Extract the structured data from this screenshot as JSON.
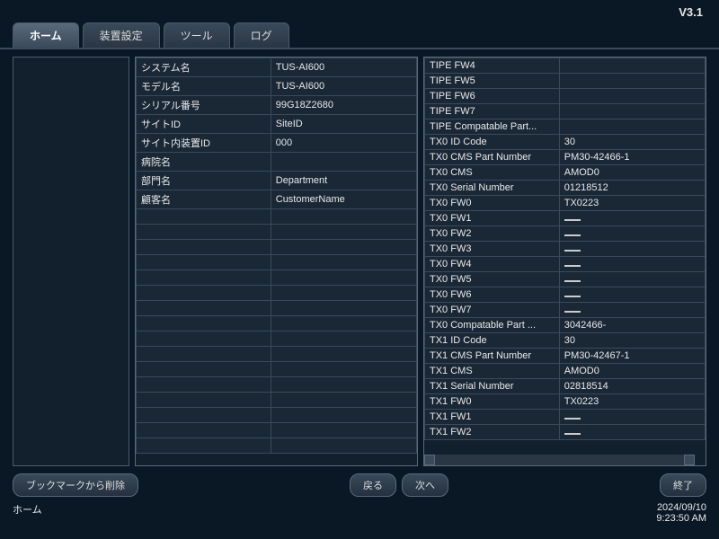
{
  "version": "V3.1",
  "tabs": [
    {
      "label": "ホーム",
      "active": true
    },
    {
      "label": "装置設定",
      "active": false
    },
    {
      "label": "ツール",
      "active": false
    },
    {
      "label": "ログ",
      "active": false
    }
  ],
  "left_table": [
    {
      "label": "システム名",
      "value": "TUS-AI600"
    },
    {
      "label": "モデル名",
      "value": "TUS-AI600"
    },
    {
      "label": "シリアル番号",
      "value": "99G18Z2680"
    },
    {
      "label": "サイトID",
      "value": "SiteID"
    },
    {
      "label": "サイト内装置ID",
      "value": "000"
    },
    {
      "label": "病院名",
      "value": ""
    },
    {
      "label": "部門名",
      "value": "Department"
    },
    {
      "label": "顧客名",
      "value": "CustomerName"
    },
    {
      "label": "",
      "value": ""
    },
    {
      "label": "",
      "value": ""
    },
    {
      "label": "",
      "value": ""
    },
    {
      "label": "",
      "value": ""
    },
    {
      "label": "",
      "value": ""
    },
    {
      "label": "",
      "value": ""
    },
    {
      "label": "",
      "value": ""
    },
    {
      "label": "",
      "value": ""
    },
    {
      "label": "",
      "value": ""
    },
    {
      "label": "",
      "value": ""
    },
    {
      "label": "",
      "value": ""
    },
    {
      "label": "",
      "value": ""
    },
    {
      "label": "",
      "value": ""
    },
    {
      "label": "",
      "value": ""
    },
    {
      "label": "",
      "value": ""
    },
    {
      "label": "",
      "value": ""
    }
  ],
  "right_table": [
    {
      "label": "TIPE FW4",
      "value": ""
    },
    {
      "label": "TIPE FW5",
      "value": ""
    },
    {
      "label": "TIPE FW6",
      "value": ""
    },
    {
      "label": "TIPE FW7",
      "value": ""
    },
    {
      "label": "TIPE Compatable Part...",
      "value": ""
    },
    {
      "label": "TX0 ID Code",
      "value": "30"
    },
    {
      "label": "TX0 CMS Part Number",
      "value": "PM30-42466-1"
    },
    {
      "label": "TX0 CMS",
      "value": "AMOD0"
    },
    {
      "label": "TX0 Serial Number",
      "value": "01218512"
    },
    {
      "label": "TX0 FW0",
      "value": "TX0223"
    },
    {
      "label": "TX0 FW1",
      "value": "—"
    },
    {
      "label": "TX0 FW2",
      "value": "—"
    },
    {
      "label": "TX0 FW3",
      "value": "—"
    },
    {
      "label": "TX0 FW4",
      "value": "—"
    },
    {
      "label": "TX0 FW5",
      "value": "—"
    },
    {
      "label": "TX0 FW6",
      "value": "—"
    },
    {
      "label": "TX0 FW7",
      "value": "—"
    },
    {
      "label": "TX0 Compatable Part ...",
      "value": "3042466-"
    },
    {
      "label": "TX1 ID Code",
      "value": "30"
    },
    {
      "label": "TX1 CMS Part Number",
      "value": "PM30-42467-1"
    },
    {
      "label": "TX1 CMS",
      "value": "AMOD0"
    },
    {
      "label": "TX1 Serial Number",
      "value": "02818514"
    },
    {
      "label": "TX1 FW0",
      "value": "TX0223"
    },
    {
      "label": "TX1 FW1",
      "value": "—"
    },
    {
      "label": "TX1 FW2",
      "value": "—"
    }
  ],
  "buttons": {
    "bookmark_delete": "ブックマークから削除",
    "back": "戻る",
    "next": "次へ",
    "exit": "終了"
  },
  "status": {
    "location": "ホーム",
    "date": "2024/09/10",
    "time": "9:23:50 AM"
  }
}
